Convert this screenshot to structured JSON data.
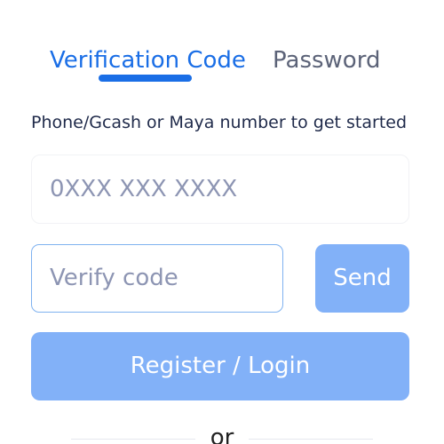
{
  "tabs": {
    "verification_code": "Verification Code",
    "password": "Password",
    "active": "verification_code"
  },
  "prompt": "Phone/Gcash or Maya number to get started",
  "phone_input": {
    "value": "",
    "placeholder": "0XXX XXX XXXX"
  },
  "code_input": {
    "value": "",
    "placeholder": "Verify code"
  },
  "send_button": "Send",
  "register_button": "Register / Login",
  "divider_text": "or",
  "colors": {
    "accent": "#1a6ee6",
    "button_bg": "#82b1f8",
    "input_focus_border": "#7fb2f0",
    "inactive_tab": "#5c6378",
    "placeholder": "#8d95b3"
  }
}
